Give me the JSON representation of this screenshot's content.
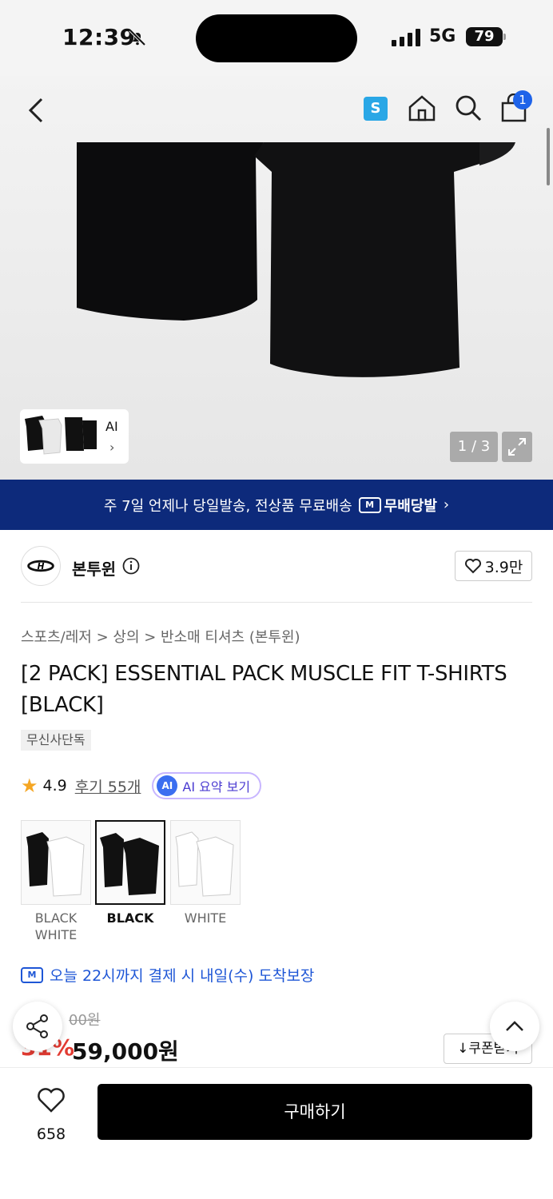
{
  "status_bar": {
    "time": "12:39",
    "network": "5G",
    "battery": "79"
  },
  "nav": {
    "store_badge": "S",
    "cart_count": "1",
    "icons": [
      "back-icon",
      "home-icon",
      "search-icon",
      "bag-icon"
    ]
  },
  "gallery": {
    "thumb_label": "AI",
    "thumb_chevron": "›",
    "pager": "1 / 3"
  },
  "banner": {
    "text": "주 7일 언제나 당일발송, 전상품 무료배송",
    "brand_badge": "M",
    "brand": "무배당발",
    "chevron": "›"
  },
  "brand": {
    "name": "본투윈",
    "likes": "3.9만"
  },
  "breadcrumb": "스포츠/레저 > 상의 > 반소매 티셔츠 (본투윈)",
  "product": {
    "title": "[2 PACK] ESSENTIAL PACK MUSCLE FIT T-SHIRTS [BLACK]",
    "exclusive": "무신사단독",
    "rating": "4.9",
    "reviews": "후기 55개",
    "ai_badge": "AI",
    "ai_summary": "AI 요약 보기"
  },
  "options": [
    {
      "label": "BLACK\nWHITE",
      "selected": false
    },
    {
      "label": "BLACK",
      "selected": true
    },
    {
      "label": "WHITE",
      "selected": false
    }
  ],
  "delivery": {
    "badge": "M",
    "text": "오늘 22시까지 결제 시 내일(수) 도착보장"
  },
  "price": {
    "original": "00원",
    "discount": "31%",
    "final": "59,000원",
    "coupon": "↓쿠폰받기"
  },
  "bottom": {
    "wish_count": "658",
    "buy": "구매하기"
  },
  "colors": {
    "accent": "#1e63e9",
    "banner": "#0d2a7b",
    "discount": "#e23b32",
    "delivery": "#1e56d6"
  }
}
